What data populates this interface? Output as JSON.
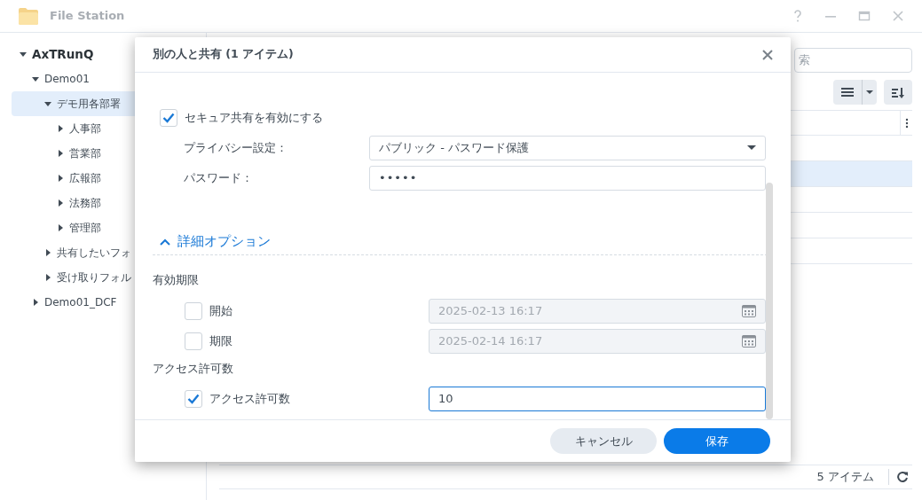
{
  "window": {
    "title": "File Station"
  },
  "sidebar": {
    "tree": [
      {
        "label": "AxTRunQ",
        "expanded": true,
        "selected": false,
        "children": [
          {
            "label": "Demo01",
            "expanded": true,
            "selected": false,
            "children": [
              {
                "label": "デモ用各部署",
                "expanded": true,
                "selected": true,
                "children": [
                  {
                    "label": "人事部",
                    "expanded": false,
                    "selected": false
                  },
                  {
                    "label": "営業部",
                    "expanded": false,
                    "selected": false
                  },
                  {
                    "label": "広報部",
                    "expanded": false,
                    "selected": false
                  },
                  {
                    "label": "法務部",
                    "expanded": false,
                    "selected": false
                  },
                  {
                    "label": "管理部",
                    "expanded": false,
                    "selected": false
                  }
                ]
              },
              {
                "label": "共有したいフォ",
                "expanded": false,
                "selected": false
              },
              {
                "label": "受け取りフォル",
                "expanded": false,
                "selected": false
              }
            ]
          },
          {
            "label": "Demo01_DCF",
            "expanded": false,
            "selected": false
          }
        ]
      }
    ]
  },
  "file_list": {
    "search": {
      "placeholder": "索"
    },
    "rows": [
      {
        "selected": false
      },
      {
        "selected": true
      },
      {
        "selected": false
      },
      {
        "selected": false
      },
      {
        "selected": false
      }
    ]
  },
  "status_bar": {
    "count": "5 アイテム"
  },
  "dialog": {
    "title": "別の人と共有 (1 アイテム)",
    "secure_share": {
      "label": "セキュア共有を有効にする",
      "checked": true
    },
    "fields": [
      {
        "kind": "select",
        "label": "プライバシー設定：",
        "value": "パブリック - パスワード保護"
      },
      {
        "kind": "password",
        "label": "パスワード：",
        "value": "•••••"
      }
    ],
    "advanced": {
      "label": "詳細オプション",
      "expanded": true
    },
    "sections": [
      {
        "title": "有効期限",
        "options": [
          {
            "kind": "date",
            "label": "開始",
            "checked": false,
            "disabled": true,
            "focused": false,
            "value": "2025-02-13 16:17"
          },
          {
            "kind": "date",
            "label": "期限",
            "checked": false,
            "disabled": true,
            "focused": false,
            "value": "2025-02-14 16:17"
          }
        ]
      },
      {
        "title": "アクセス許可数",
        "options": [
          {
            "kind": "number",
            "label": "アクセス許可数",
            "checked": true,
            "disabled": false,
            "focused": true,
            "value": "10"
          }
        ]
      }
    ],
    "buttons": [
      {
        "kind": "secondary",
        "label": "キャンセル"
      },
      {
        "kind": "primary",
        "label": "保存"
      }
    ]
  }
}
